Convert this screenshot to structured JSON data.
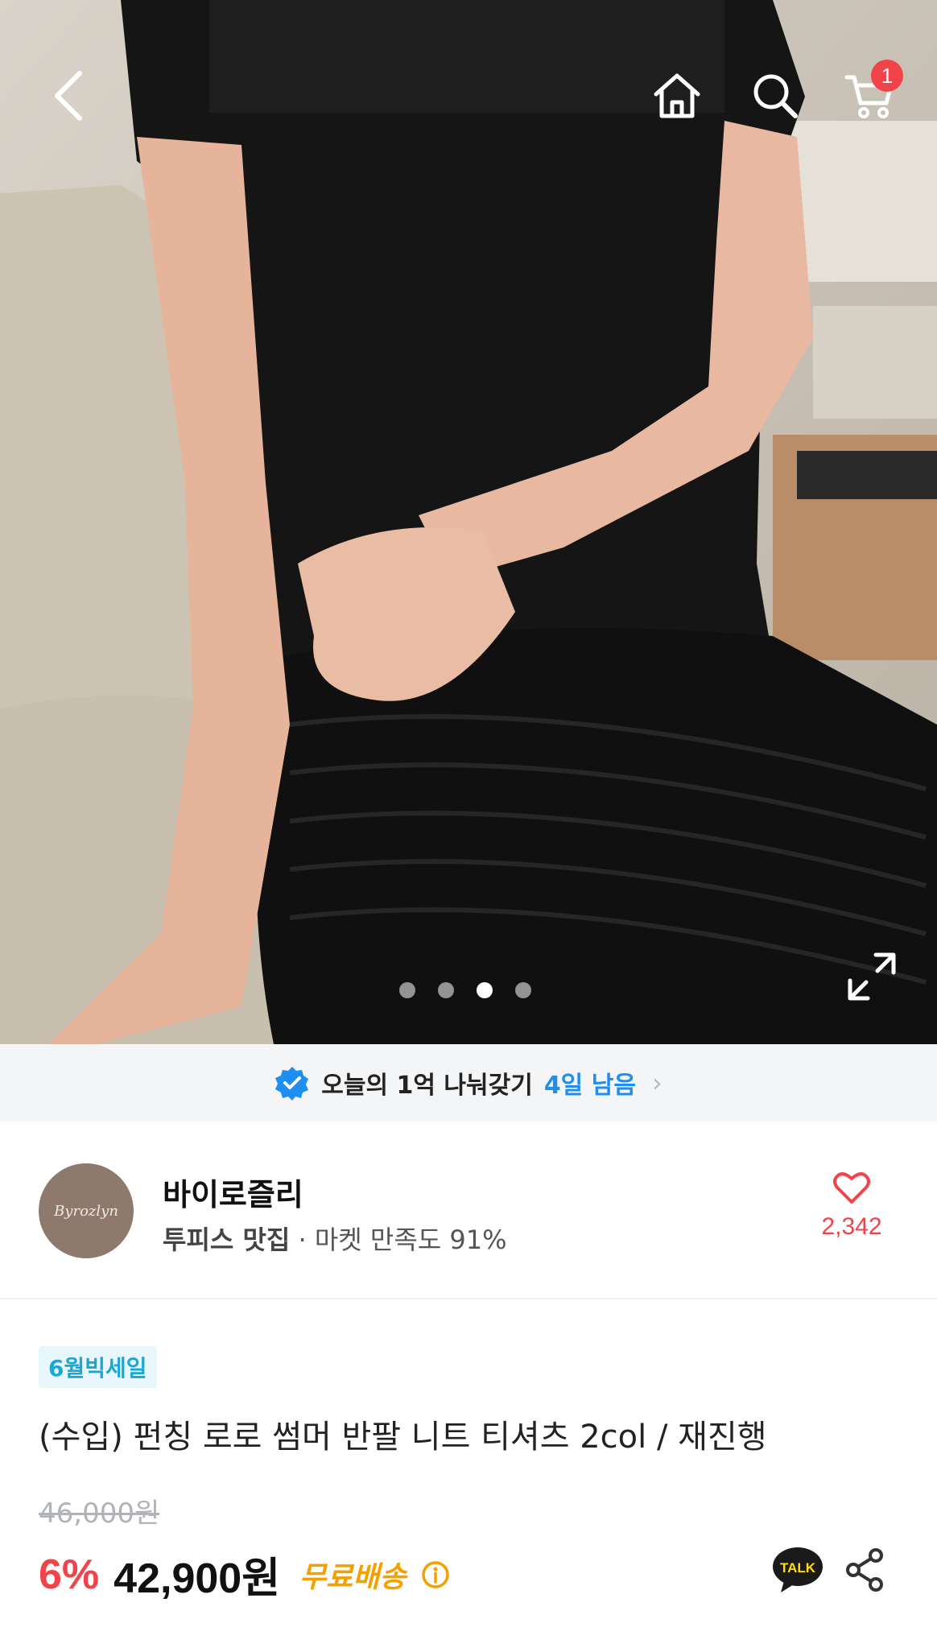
{
  "nav": {
    "cart_count": "1"
  },
  "carousel": {
    "dot_count": 4,
    "active_index": 2
  },
  "event": {
    "text": "오늘의 1억 나눠갖기",
    "days_left": "4일 남음"
  },
  "shop": {
    "logo_text": "Byrozlyn",
    "name": "바이로즐리",
    "category": "투피스 맛집",
    "satisfaction": "· 마켓 만족도 91%",
    "like_count": "2,342"
  },
  "product": {
    "tag": "6월빅세일",
    "title": "(수입) 펀칭 로로 썸머 반팔 니트 티셔츠 2col / 재진행",
    "original_price": "46,000원",
    "discount": "6%",
    "price": "42,900원",
    "shipping": "무료배송"
  },
  "colors": {
    "accent_red": "#f0444a",
    "accent_blue": "#1f8ef1",
    "shipping_orange": "#f5a000"
  },
  "icons": [
    "back-icon",
    "home-icon",
    "search-icon",
    "cart-icon",
    "expand-icon",
    "verified-badge-icon",
    "chevron-right-icon",
    "heart-icon",
    "info-icon",
    "kakao-talk-icon",
    "share-icon"
  ]
}
